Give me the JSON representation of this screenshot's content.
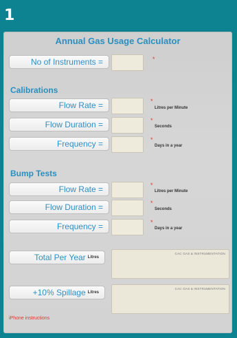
{
  "badge": "1",
  "title": "Annual Gas Usage Calculator",
  "instruments": {
    "label": "No of Instruments =",
    "star": "*"
  },
  "calibrations": {
    "heading": "Calibrations",
    "rows": [
      {
        "label": "Flow Rate =",
        "star": "*",
        "unit": "Litres per Minute"
      },
      {
        "label": "Flow Duration =",
        "star": "*",
        "unit": "Seconds"
      },
      {
        "label": "Frequency =",
        "star": "*",
        "unit": "Days in a year"
      }
    ]
  },
  "bump": {
    "heading": "Bump Tests",
    "rows": [
      {
        "label": "Flow Rate =",
        "star": "*",
        "unit": "Litres per Minute"
      },
      {
        "label": "Flow Duration =",
        "star": "*",
        "unit": "Seconds"
      },
      {
        "label": "Frequency =",
        "star": "*",
        "unit": "Days in a year"
      }
    ]
  },
  "total": {
    "label": "Total Per Year",
    "unit": "Litres",
    "watermark": "CAC GAS & INSTRUMENTATION"
  },
  "spillage": {
    "label": "+10% Spillage",
    "unit": "Litres",
    "watermark": "CAC GAS & INSTRUMENTATION"
  },
  "footer": {
    "iphone_link": "iPhone instructions"
  },
  "colors": {
    "background": "#0d8391",
    "accent": "#2a8fc0",
    "required": "#e0392b"
  }
}
